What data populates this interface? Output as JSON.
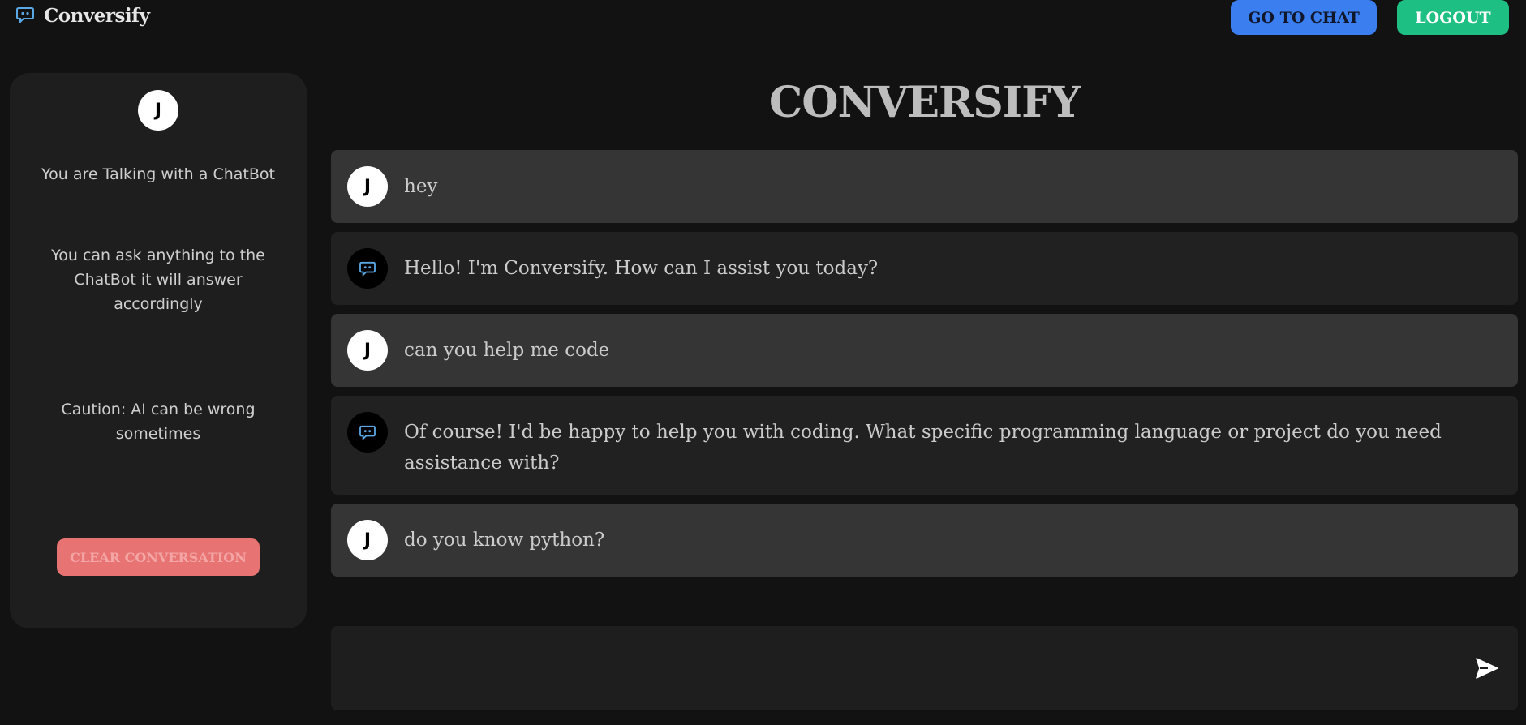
{
  "header": {
    "brand": "Conversify",
    "go_to_chat": "GO TO CHAT",
    "logout": "LOGOUT"
  },
  "sidebar": {
    "avatar_initial": "J",
    "info_1": "You are Talking with a ChatBot",
    "info_2": "You can ask anything to the ChatBot it will answer accordingly",
    "info_3": "Caution: AI can be wrong sometimes",
    "clear_button": "CLEAR CONVERSATION"
  },
  "main": {
    "title": "CONVERSIFY",
    "messages": [
      {
        "role": "user",
        "avatar": "J",
        "text": "hey"
      },
      {
        "role": "assistant",
        "avatar": "chatbot-icon",
        "text": "Hello! I'm Conversify. How can I assist you today?"
      },
      {
        "role": "user",
        "avatar": "J",
        "text": "can you help me code"
      },
      {
        "role": "assistant",
        "avatar": "chatbot-icon",
        "text": "Of course! I'd be happy to help you with coding. What specific programming language or project do you need assistance with?"
      },
      {
        "role": "user",
        "avatar": "J",
        "text": "do you know python?"
      }
    ],
    "input": {
      "value": "",
      "placeholder": ""
    },
    "send_icon": "send-icon"
  },
  "colors": {
    "background": "#121212",
    "panel": "#1e1e1e",
    "user_bubble": "#353535",
    "bot_bubble": "#212121",
    "chat_button": "#3a7ef0",
    "logout_button": "#1dbf83",
    "clear_button": "#e87373",
    "bot_icon": "#5aa9e6"
  }
}
